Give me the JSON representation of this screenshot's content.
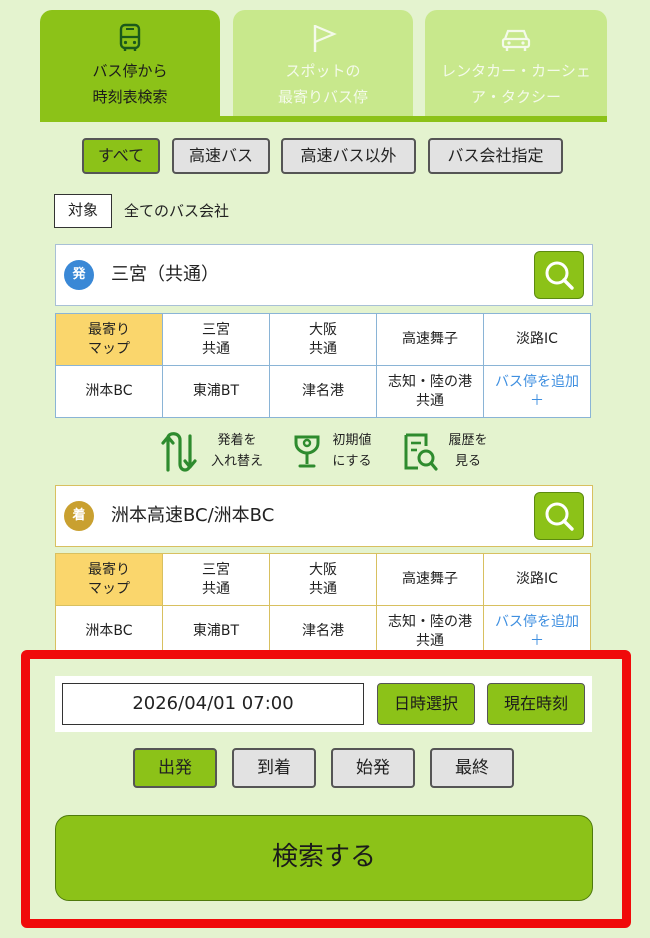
{
  "tabs": [
    {
      "line1": "バス停から",
      "line2": "時刻表検索",
      "icon": "bus-icon"
    },
    {
      "line1": "スポットの",
      "line2": "最寄りバス停",
      "icon": "flag-icon"
    },
    {
      "line1": "レンタカー・カーシェ",
      "line2": "ア・タクシー",
      "icon": "car-icon"
    }
  ],
  "filters": [
    "すべて",
    "高速バス",
    "高速バス以外",
    "バス会社指定"
  ],
  "target": {
    "label": "対象",
    "value": "全てのバス会社"
  },
  "departure": {
    "badge": "発",
    "station": "三宮（共通）",
    "grid": [
      [
        {
          "l1": "最寄り",
          "l2": "マップ"
        },
        {
          "l1": "三宮",
          "l2": "共通"
        },
        {
          "l1": "大阪",
          "l2": "共通"
        },
        {
          "l1": "高速舞子",
          "l2": ""
        },
        {
          "l1": "淡路IC",
          "l2": ""
        }
      ],
      [
        {
          "l1": "洲本BC",
          "l2": ""
        },
        {
          "l1": "東浦BT",
          "l2": ""
        },
        {
          "l1": "津名港",
          "l2": ""
        },
        {
          "l1": "志知・陸の港",
          "l2": "共通"
        },
        {
          "l1": "バス停を追加",
          "l2": "＋"
        }
      ]
    ]
  },
  "tools": [
    {
      "l1": "発着を",
      "l2": "入れ替え",
      "icon": "swap-icon"
    },
    {
      "l1": "初期値",
      "l2": "にする",
      "icon": "reset-icon"
    },
    {
      "l1": "履歴を",
      "l2": "見る",
      "icon": "history-icon"
    }
  ],
  "arrival": {
    "badge": "着",
    "station": "洲本高速BC/洲本BC",
    "grid": [
      [
        {
          "l1": "最寄り",
          "l2": "マップ"
        },
        {
          "l1": "三宮",
          "l2": "共通"
        },
        {
          "l1": "大阪",
          "l2": "共通"
        },
        {
          "l1": "高速舞子",
          "l2": ""
        },
        {
          "l1": "淡路IC",
          "l2": ""
        }
      ],
      [
        {
          "l1": "洲本BC",
          "l2": ""
        },
        {
          "l1": "東浦BT",
          "l2": ""
        },
        {
          "l1": "津名港",
          "l2": ""
        },
        {
          "l1": "志知・陸の港",
          "l2": "共通"
        },
        {
          "l1": "バス停を追加",
          "l2": "＋"
        }
      ]
    ]
  },
  "datetime": {
    "value": "2026/04/01  07:00",
    "select_label": "日時選択",
    "now_label": "現在時刻"
  },
  "mode_buttons": [
    "出発",
    "到着",
    "始発",
    "最終"
  ],
  "search_label": "検索する",
  "colors": {
    "accent": "#8cc218",
    "background": "#e4f3cf",
    "highlight": "#f00a0a"
  }
}
